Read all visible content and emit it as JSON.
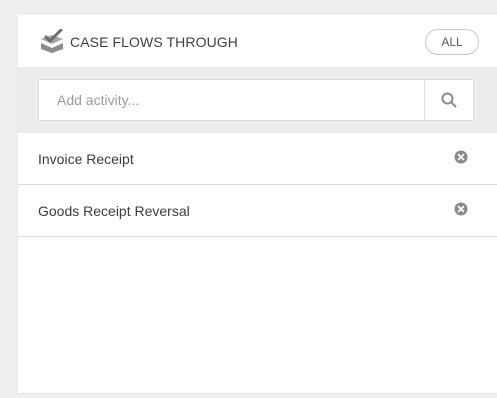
{
  "header": {
    "title": "CASE FLOWS THROUGH",
    "icon": "checkbox-stack-icon",
    "all_button_label": "ALL"
  },
  "search": {
    "placeholder": "Add activity...",
    "value": "",
    "icon": "search-icon"
  },
  "activities": [
    {
      "label": "Invoice Receipt",
      "remove_icon": "close-circle-icon"
    },
    {
      "label": "Goods Receipt Reversal",
      "remove_icon": "close-circle-icon"
    }
  ],
  "colors": {
    "background": "#efefef",
    "panel": "#ffffff",
    "search_area": "#ececec",
    "icon_gray": "#8a8a8a"
  }
}
